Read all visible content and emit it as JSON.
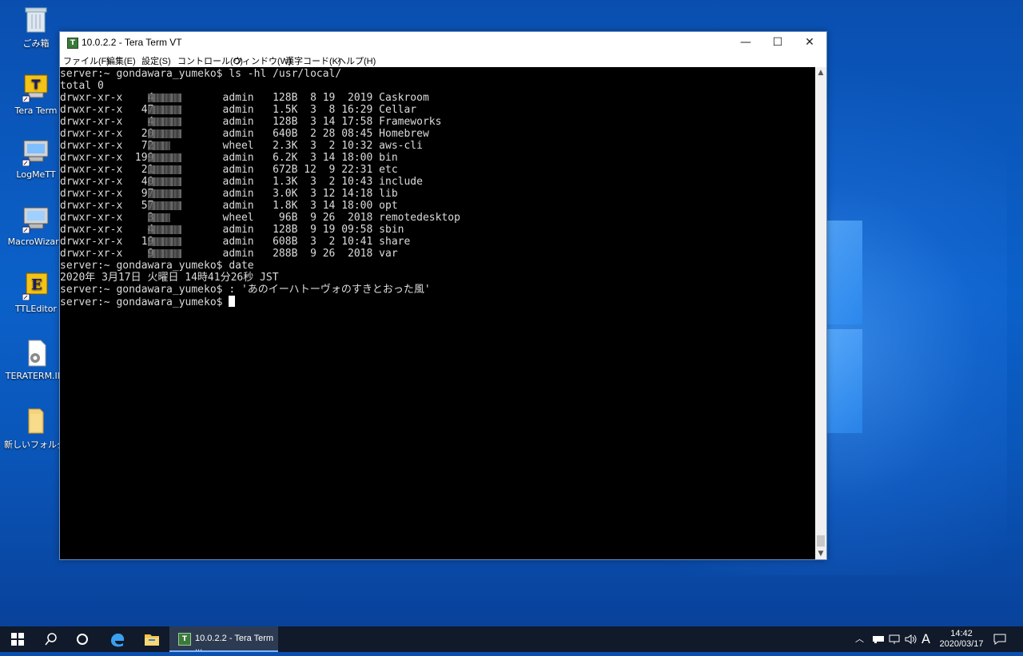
{
  "desktop": {
    "icons": [
      {
        "label": "ごみ箱",
        "icon": "recycle-bin-icon"
      },
      {
        "label": "Tera Term",
        "icon": "teraterm-icon"
      },
      {
        "label": "LogMeTT",
        "icon": "logmett-icon"
      },
      {
        "label": "MacroWizard",
        "icon": "macrowizard-icon"
      },
      {
        "label": "TTLEditor",
        "icon": "ttleditor-icon"
      },
      {
        "label": "TERATERM.INI",
        "icon": "ini-file-icon"
      },
      {
        "label": "新しいフォルダー",
        "icon": "folder-icon"
      }
    ]
  },
  "window": {
    "title": "10.0.2.2 - Tera Term VT",
    "controls": {
      "minimize": "—",
      "maximize": "☐",
      "close": "✕"
    },
    "menu": [
      "ファイル(F)",
      "編集(E)",
      "設定(S)",
      "コントロール(O)",
      "ウィンドウ(W)",
      "漢字コード(K)",
      "ヘルプ(H)"
    ]
  },
  "terminal": {
    "lines": [
      "server:~ gondawara_yumeko$ ls -hl /usr/local/",
      "total 0",
      "drwxr-xr-x    4           admin   128B  8 19  2019 Caskroom",
      "drwxr-xr-x   47           admin   1.5K  3  8 16:29 Cellar",
      "drwxr-xr-x    4           admin   128B  3 14 17:58 Frameworks",
      "drwxr-xr-x   20           admin   640B  2 28 08:45 Homebrew",
      "drwxr-xr-x   72           wheel   2.3K  3  2 10:32 aws-cli",
      "drwxr-xr-x  199           admin   6.2K  3 14 18:00 bin",
      "drwxr-xr-x   21           admin   672B 12  9 22:31 etc",
      "drwxr-xr-x   40           admin   1.3K  3  2 10:43 include",
      "drwxr-xr-x   97           admin   3.0K  3 12 14:18 lib",
      "drwxr-xr-x   57           admin   1.8K  3 14 18:00 opt",
      "drwxr-xr-x    3           wheel    96B  9 26  2018 remotedesktop",
      "drwxr-xr-x    4           admin   128B  9 19 09:58 sbin",
      "drwxr-xr-x   19           admin   608B  3  2 10:41 share",
      "drwxr-xr-x    9           admin   288B  9 26  2018 var",
      "server:~ gondawara_yumeko$ date",
      "2020年 3月17日 火曜日 14時41分26秒 JST",
      "server:~ gondawara_yumeko$ : 'あのイーハトーヴォのすきとおった風'",
      "server:~ gondawara_yumeko$ "
    ]
  },
  "taskbar": {
    "start": "start-icon",
    "search": "search-icon",
    "taskview": "task-view-icon",
    "edge": "edge-icon",
    "explorer": "file-explorer-icon",
    "active_app": "10.0.2.2 - Tera Term ...",
    "ime": "A",
    "time": "14:42",
    "date": "2020/03/17"
  }
}
